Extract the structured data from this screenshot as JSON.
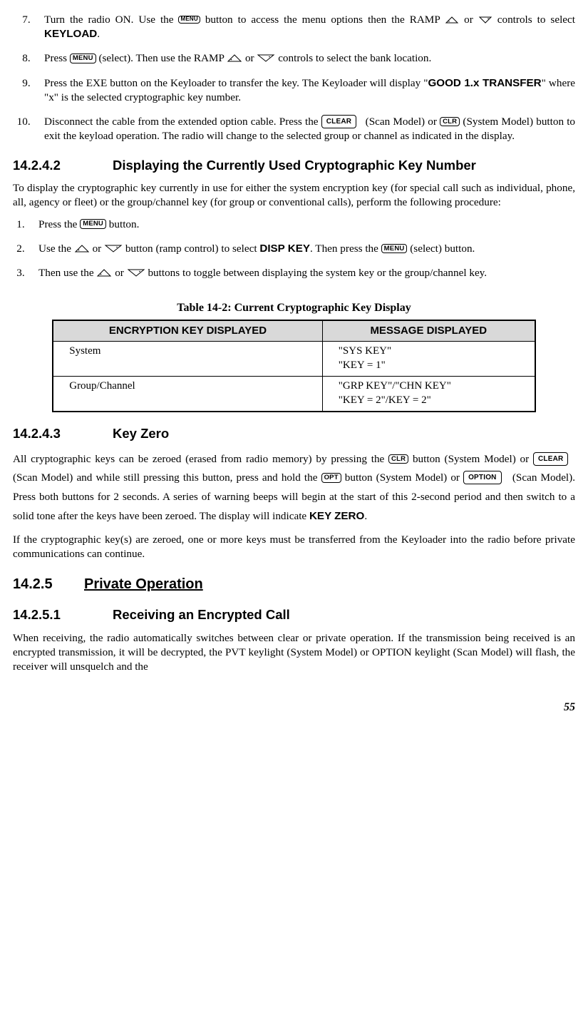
{
  "buttons": {
    "menu": "MENU",
    "clear_big": "CLEAR",
    "clr": "CLR",
    "opt": "OPT",
    "option_big": "OPTION"
  },
  "steps_a": {
    "s7_a": "Turn the radio ON. Use the ",
    "s7_b": " button to access the menu options then the RAMP ",
    "s7_c": " or ",
    "s7_d": " controls to select ",
    "s7_key": "KEYLOAD",
    "s7_e": ".",
    "s8_a": "Press ",
    "s8_b": " (select). Then use the RAMP ",
    "s8_c": " or ",
    "s8_d": " controls to select the bank location.",
    "s9_a": "Press the EXE button on the Keyloader to transfer the key. The Keyloader will display \"",
    "s9_key": "GOOD 1.x TRANSFER",
    "s9_b": "\" where \"x\" is the selected cryptographic key number.",
    "s10_a": "Disconnect the cable from the extended option cable. Press the ",
    "s10_b": " (Scan Model) or ",
    "s10_c": " (System Model) button to exit the keyload operation. The radio will change to the selected group or channel as indicated in the display."
  },
  "sec_14_2_4_2": {
    "num": "14.2.4.2",
    "title": "Displaying the Currently Used Cryptographic Key Number",
    "intro": "To display the cryptographic key currently in use for either the system encryption key (for special call such as individual, phone, all, agency or fleet) or the group/channel key (for group or conventional calls), perform the following procedure:",
    "s1_a": "Press the ",
    "s1_b": " button.",
    "s2_a": "Use the ",
    "s2_b": " or ",
    "s2_c": " button (ramp control) to select ",
    "s2_key": "DISP KEY",
    "s2_d": ". Then press the ",
    "s2_e": " (select) button.",
    "s3_a": "Then use the ",
    "s3_b": " or ",
    "s3_c": " buttons to toggle between displaying the system key or the group/channel key."
  },
  "table": {
    "caption": "Table 14-2:  Current Cryptographic Key Display",
    "h1": "ENCRYPTION KEY DISPLAYED",
    "h2": "MESSAGE DISPLAYED",
    "r1c1": "System",
    "r1c2a": "\"SYS KEY\"",
    "r1c2b": "\"KEY = 1\"",
    "r2c1": "Group/Channel",
    "r2c2a": "\"GRP KEY\"/\"CHN KEY\"",
    "r2c2b": "\"KEY = 2\"/KEY = 2\""
  },
  "sec_14_2_4_3": {
    "num": "14.2.4.3",
    "title": "Key Zero",
    "p_a": "All cryptographic keys can be zeroed (erased from radio memory) by pressing the ",
    "p_b": " button (System Model) or ",
    "p_c": " (Scan Model) and while still pressing this button, press and hold the ",
    "p_d": " button (System Model) or ",
    "p_e": " (Scan Model). Press both buttons for 2 seconds. A series of warning beeps will begin at the start of this 2-second period and then switch to a solid tone after the keys have been zeroed. The display will indicate ",
    "p_key": "KEY ZERO",
    "p_f": ".",
    "p2": "If the cryptographic key(s) are zeroed, one or more keys must be transferred from the Keyloader into the radio before private communications can continue."
  },
  "sec_14_2_5": {
    "num": "14.2.5",
    "title": "Private Operation"
  },
  "sec_14_2_5_1": {
    "num": "14.2.5.1",
    "title": "Receiving an Encrypted Call",
    "p": "When receiving, the radio automatically switches between clear or private operation. If the transmission being received is an encrypted transmission, it will be decrypted, the PVT keylight (System Model) or OPTION keylight (Scan Model) will flash, the receiver will unsquelch and the"
  },
  "page_num": "55"
}
